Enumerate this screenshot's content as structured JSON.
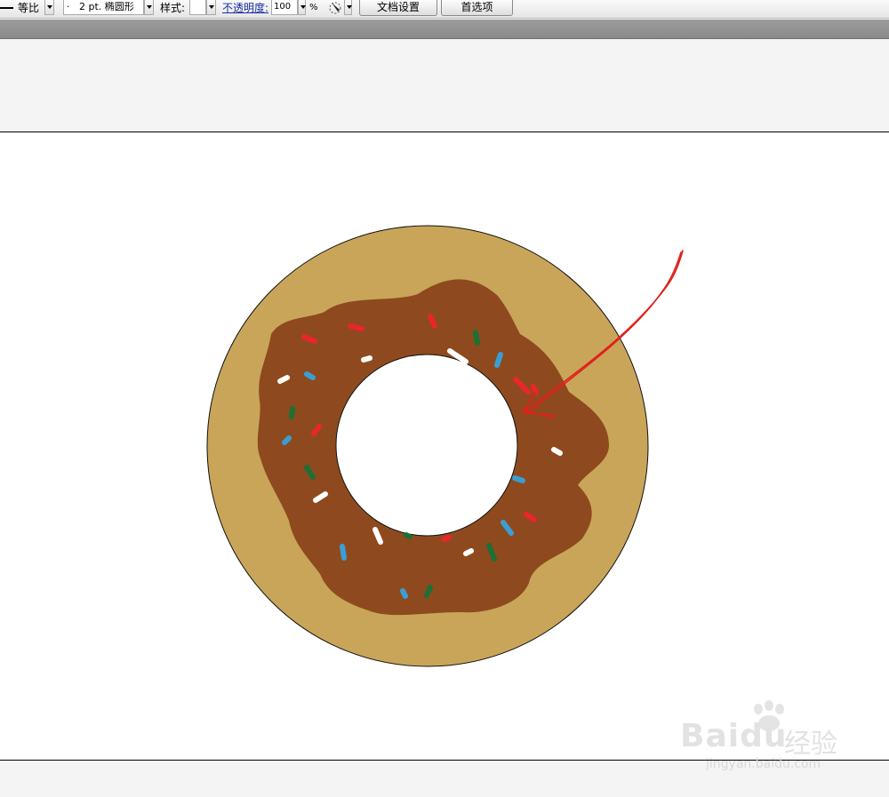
{
  "control_bar": {
    "profile_label": "等比",
    "brush_value": "2 pt. 椭圆形",
    "brush_dot": "·",
    "style_label": "样式:",
    "opacity_label": "不透明度:",
    "opacity_value": "100",
    "opacity_unit": "%",
    "document_setup_button": "文档设置",
    "preferences_button": "首选项"
  },
  "artwork": {
    "description_colors": {
      "dough": "#c9a55a",
      "icing": "#8e4a1e",
      "hole": "#ffffff",
      "arrow": "#e0201a",
      "sprinkle_red": "#e8262b",
      "sprinkle_green": "#1d6f36",
      "sprinkle_blue": "#3a9ed6",
      "sprinkle_white": "#ffffff"
    }
  },
  "watermark": {
    "brand": "Bai",
    "brand_suffix": "du",
    "product": "经验",
    "url": "jingyan.baidu.com"
  }
}
